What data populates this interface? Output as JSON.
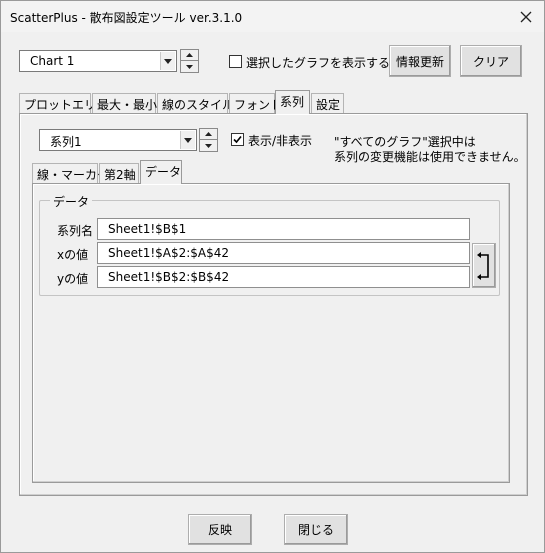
{
  "window": {
    "title": "ScatterPlus - 散布図設定ツール ver.3.1.0",
    "close_icon": "close-icon"
  },
  "top": {
    "chart_select_value": "Chart 1",
    "show_selected_label": "選択したグラフを表示する",
    "show_selected_checked": false,
    "refresh_label": "情報更新",
    "clear_label": "クリア"
  },
  "main_tabs": [
    {
      "label": "プロットエリア",
      "active": false
    },
    {
      "label": "最大・最小",
      "active": false
    },
    {
      "label": "線のスタイル",
      "active": false
    },
    {
      "label": "フォント",
      "active": false
    },
    {
      "label": "系列",
      "active": true
    },
    {
      "label": "設定",
      "active": false
    }
  ],
  "series_tab": {
    "series_select_value": "系列1",
    "show_hide_label": "表示/非表示",
    "show_hide_checked": true,
    "note_line1": "\"すべてのグラフ\"選択中は",
    "note_line2": "系列の変更機能は使用できません。",
    "sub_tabs": [
      {
        "label": "線・マーカー",
        "active": false
      },
      {
        "label": "第2軸",
        "active": false
      },
      {
        "label": "データ",
        "active": true
      }
    ],
    "data_group": {
      "legend": "データ",
      "fields": [
        {
          "label": "系列名",
          "value": "Sheet1!$B$1"
        },
        {
          "label": "xの値",
          "value": "Sheet1!$A$2:$A$42"
        },
        {
          "label": "yの値",
          "value": "Sheet1!$B$2:$B$42"
        }
      ],
      "swap_icon": "swap-arrow-icon"
    }
  },
  "bottom": {
    "apply_label": "反映",
    "close_label": "閉じる"
  }
}
